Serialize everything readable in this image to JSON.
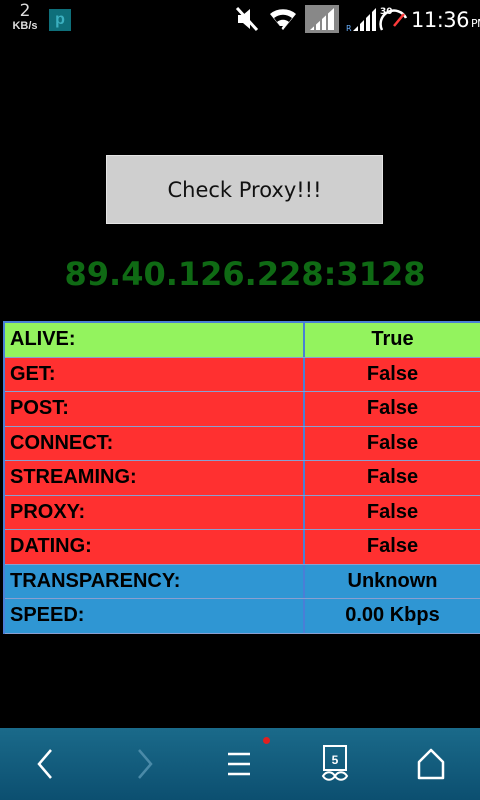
{
  "status_bar": {
    "net_speed_value": "2",
    "net_speed_unit": "KB/s",
    "app_notification_icon": "p-app-icon",
    "icons": [
      "mute-icon",
      "wifi-icon",
      "data-signal-icon",
      "cell-signal-icon",
      "speedometer-icon"
    ],
    "speedometer_value": "30",
    "time": "11:36",
    "ampm": "PM"
  },
  "main": {
    "check_button_label": "Check Proxy!!!",
    "proxy_address": "89.40.126.228:3128"
  },
  "results": [
    {
      "label": "ALIVE:",
      "value": "True",
      "status": "ok"
    },
    {
      "label": "GET:",
      "value": "False",
      "status": "fail"
    },
    {
      "label": "POST:",
      "value": "False",
      "status": "fail"
    },
    {
      "label": "CONNECT:",
      "value": "False",
      "status": "fail"
    },
    {
      "label": "STREAMING:",
      "value": "False",
      "status": "fail"
    },
    {
      "label": "PROXY:",
      "value": "False",
      "status": "fail"
    },
    {
      "label": "DATING:",
      "value": "False",
      "status": "fail"
    },
    {
      "label": "TRANSPARENCY:",
      "value": "Unknown",
      "status": "info"
    },
    {
      "label": "SPEED:",
      "value": "0.00 Kbps",
      "status": "info"
    }
  ],
  "colors": {
    "ok": "#93f35e",
    "fail": "#ff3030",
    "info": "#2f96d3",
    "proxy_text": "#0f6a14"
  },
  "nav_bar": {
    "tab_count": "5",
    "items": [
      "back-icon",
      "forward-icon",
      "menu-icon",
      "tabs-icon",
      "home-icon"
    ]
  }
}
